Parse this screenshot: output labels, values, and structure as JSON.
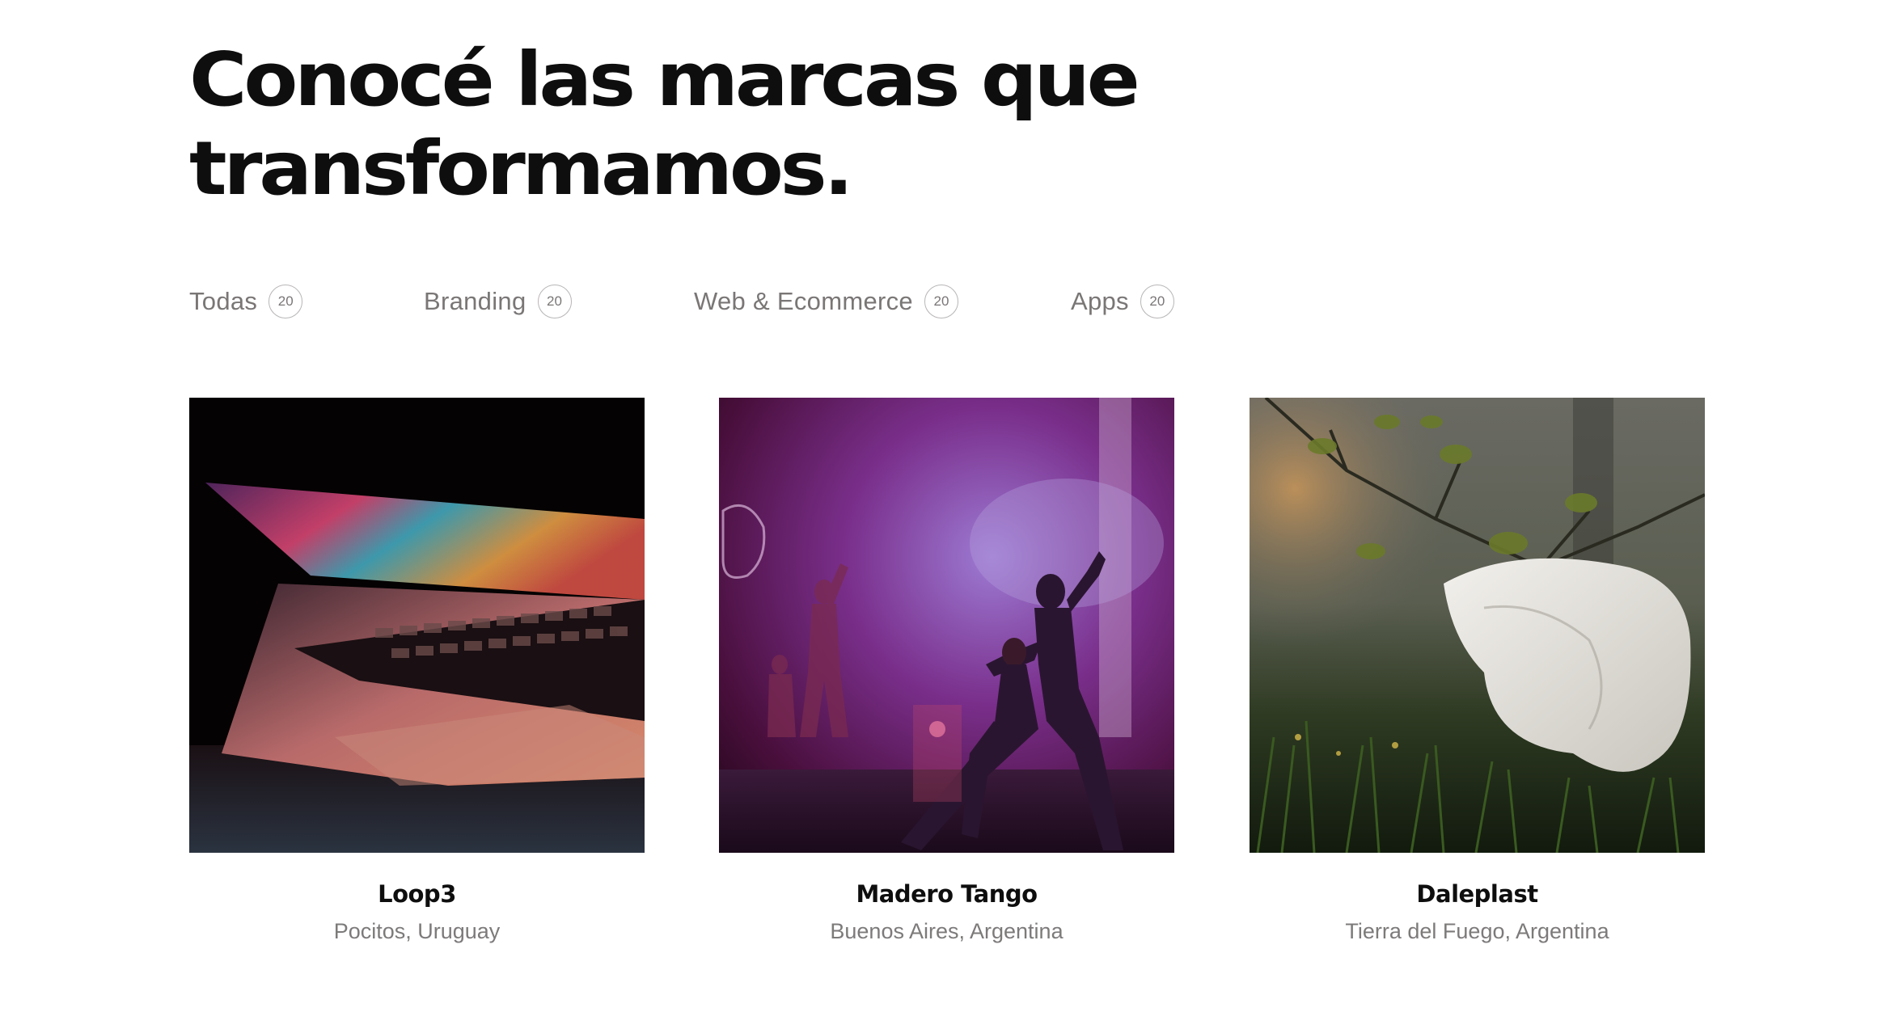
{
  "section": {
    "heading": "Conocé las marcas que transformamos."
  },
  "filters": [
    {
      "label": "Todas",
      "count": "20"
    },
    {
      "label": "Branding",
      "count": "20"
    },
    {
      "label": "Web & Ecommerce",
      "count": "20"
    },
    {
      "label": "Apps",
      "count": "20"
    }
  ],
  "projects": [
    {
      "name": "Loop3",
      "location": "Pocitos, Uruguay",
      "image_icon": "laptop-photo"
    },
    {
      "name": "Madero Tango",
      "location": "Buenos Aires, Argentina",
      "image_icon": "tango-dancers-photo"
    },
    {
      "name": "Daleplast",
      "location": "Tierra del Fuego, Argentina",
      "image_icon": "plastic-bag-on-tree-photo"
    }
  ]
}
